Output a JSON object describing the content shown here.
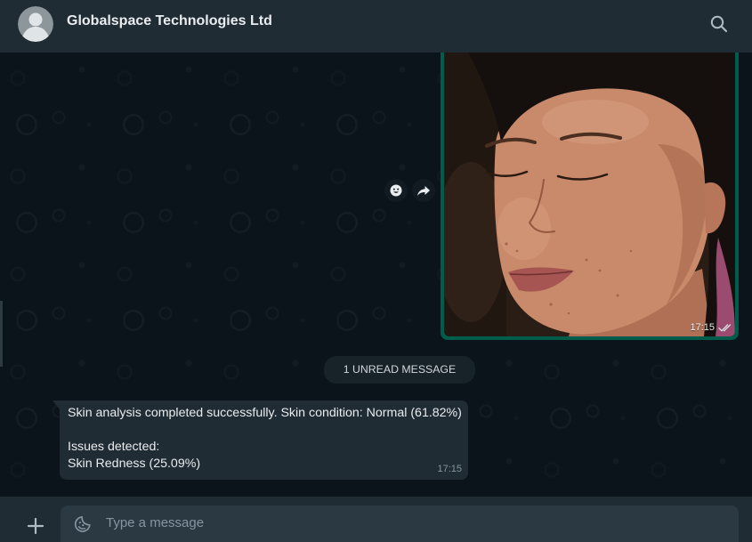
{
  "header": {
    "title": "Globalspace Technologies Ltd",
    "avatar_icon": "default-avatar-icon",
    "search_icon": "search-icon"
  },
  "messages": [
    {
      "direction": "outgoing",
      "type": "image",
      "time": "17:15",
      "status_icon": "double-check-icon",
      "hover_actions": [
        {
          "icon": "emoji-reaction-icon"
        },
        {
          "icon": "forward-icon"
        }
      ]
    },
    {
      "direction": "incoming",
      "type": "text",
      "text": "Skin analysis completed successfully. Skin condition: Normal (61.82%)\n\nIssues detected:\nSkin Redness (25.09%)",
      "time": "17:15"
    }
  ],
  "unread_divider": {
    "label": "1 UNREAD MESSAGE"
  },
  "composer": {
    "placeholder": "Type a message",
    "value": "",
    "attach_icon": "plus-icon",
    "emoji_icon": "emoji-icon"
  },
  "colors": {
    "header_bg": "#202c33",
    "chat_bg": "#0b141a",
    "outgoing_bubble": "#005c4b",
    "incoming_bubble": "#202c33",
    "unread_pill": "#182229",
    "input_bg": "#2a3942",
    "text": "#e9edef",
    "muted": "#8696a0"
  }
}
